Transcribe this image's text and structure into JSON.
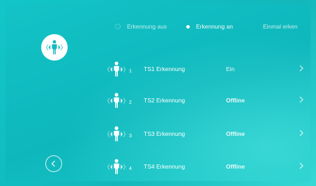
{
  "modes": [
    {
      "label": "Erkennung aus",
      "selected": false
    },
    {
      "label": "Erkennung an",
      "selected": true
    },
    {
      "label": "Einmal erken",
      "selected": false
    }
  ],
  "app_icon": "motion-detection-person-icon",
  "back_icon": "chevron-left-icon",
  "sensors": [
    {
      "index": "1",
      "name": "TS1 Erkennung",
      "status": "Ein"
    },
    {
      "index": "2",
      "name": "TS2 Erkennung",
      "status": "Offline"
    },
    {
      "index": "3",
      "name": "TS3 Erkennung",
      "status": "Offline"
    },
    {
      "index": "4",
      "name": "TS4 Erkennung",
      "status": "Offline"
    }
  ],
  "colors": {
    "background": "#12bfc2",
    "foreground": "#ffffff",
    "icon": "#15b9bd"
  }
}
